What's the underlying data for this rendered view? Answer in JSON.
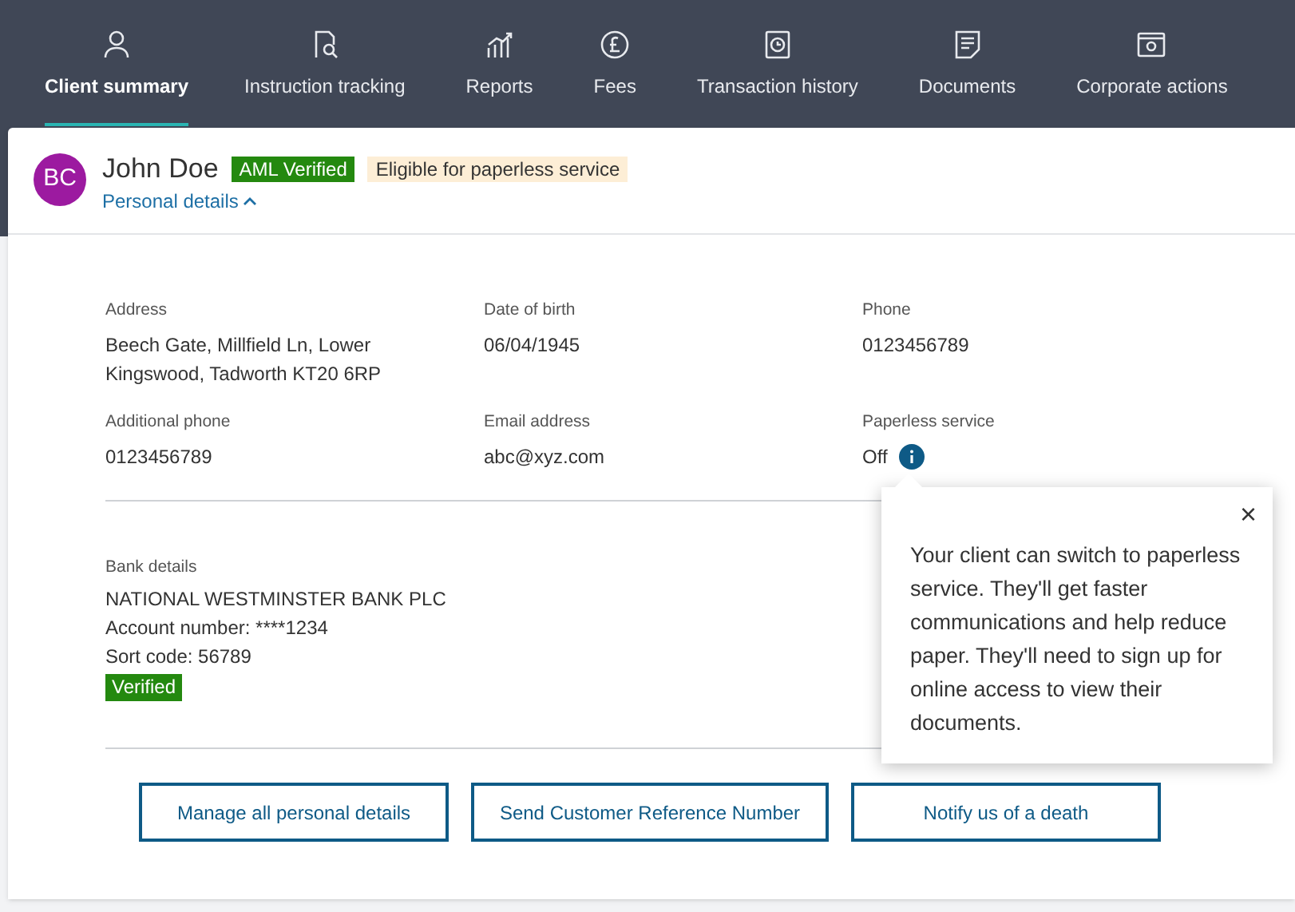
{
  "nav_tabs": [
    {
      "label": "Client summary",
      "selected": true
    },
    {
      "label": "Instruction tracking",
      "selected": false
    },
    {
      "label": "Reports",
      "selected": false
    },
    {
      "label": "Fees",
      "selected": false
    },
    {
      "label": "Transaction history",
      "selected": false
    },
    {
      "label": "Documents",
      "selected": false
    },
    {
      "label": "Corporate actions",
      "selected": false
    }
  ],
  "client": {
    "initials": "BC",
    "name": "John Doe",
    "badges": [
      {
        "label": "AML Verified",
        "kind": "success"
      },
      {
        "label": "Eligible for paperless service",
        "kind": "notice"
      }
    ],
    "details_link": "Personal details",
    "expanded": true
  },
  "fields": [
    {
      "label": "Address",
      "value": "Beech Gate, Millfield Ln, Lower Kingswood, Tadworth KT20 6RP",
      "kind": "text"
    },
    {
      "label": "Date of birth",
      "value": "06/04/1945",
      "kind": "text"
    },
    {
      "label": "Phone",
      "value": "0123456789",
      "kind": "text"
    },
    {
      "label": "Additional phone",
      "value": "0123456789",
      "kind": "text"
    },
    {
      "label": "Email address",
      "value": "abc@xyz.com",
      "kind": "text"
    },
    {
      "label": "Paperless service",
      "value": "Off",
      "kind": "info"
    }
  ],
  "bank": {
    "label": "Bank details",
    "lines": [
      "NATIONAL WESTMINSTER BANK PLC",
      "Account number: ****1234",
      "Sort code: 56789"
    ],
    "badge": "Verified"
  },
  "buttons": [
    "Manage all personal details",
    "Send Customer Reference Number",
    "Notify us of a death"
  ],
  "popover": {
    "text": "Your client can switch to paperless service. They'll get faster communications and help reduce paper. They'll need to sign up for online access to view their documents.",
    "close": "×"
  }
}
